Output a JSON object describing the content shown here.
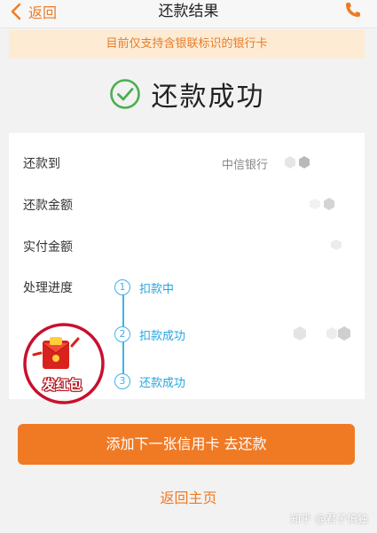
{
  "nav": {
    "back_label": "返回",
    "title": "还款结果"
  },
  "notice": "目前仅支持含银联标识的银行卡",
  "result": {
    "text": "还款成功"
  },
  "details": {
    "repay_to_label": "还款到",
    "repay_to_value": "中信银行",
    "amount_label": "还款金额",
    "paid_label": "实付金额",
    "progress_label": "处理进度"
  },
  "steps": [
    {
      "num": "1",
      "label": "扣款中"
    },
    {
      "num": "2",
      "label": "扣款成功"
    },
    {
      "num": "3",
      "label": "还款成功"
    }
  ],
  "redpack": {
    "label": "发红包"
  },
  "cta_label": "添加下一张信用卡 去还款",
  "home_label": "返回主页",
  "watermark": "知乎 @君子慎独",
  "colors": {
    "accent": "#f07a24",
    "notice_bg": "#fdebd3",
    "success": "#4caf50",
    "step_blue": "#3fb2e7",
    "redpack": "#d9221c"
  }
}
